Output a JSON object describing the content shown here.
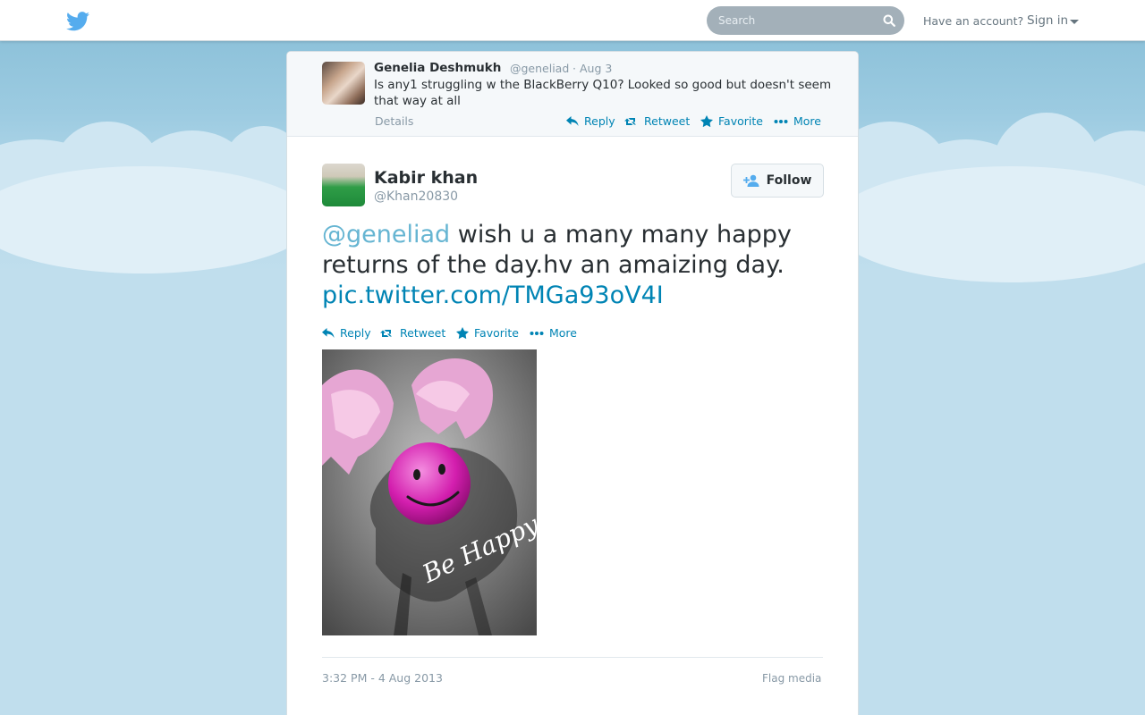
{
  "topbar": {
    "search_placeholder": "Search",
    "have_account": "Have an account?",
    "sign_in": "Sign in"
  },
  "colors": {
    "link": "#0084b4",
    "muted": "#8899a6",
    "text": "#292f33",
    "background": "#c0deed",
    "twitter_blue": "#55acee"
  },
  "ancestor_tweet": {
    "name": "Genelia Deshmukh",
    "handle": "@geneliad",
    "separator": "·",
    "date": "Aug 3",
    "text": "Is any1 struggling w the BlackBerry Q10? Looked so good but doesn't seem that way at all",
    "details": "Details",
    "actions": {
      "reply": "Reply",
      "retweet": "Retweet",
      "favorite": "Favorite",
      "more": "More"
    }
  },
  "main_tweet": {
    "name": "Kabir khan",
    "handle": "@Khan20830",
    "follow_label": "Follow",
    "mention": "@geneliad",
    "text": " wish u a many many happy returns of the day.hv an amaizing day. ",
    "link": "pic.twitter.com/TMGa93oV4I",
    "actions": {
      "reply": "Reply",
      "retweet": "Retweet",
      "favorite": "Favorite",
      "more": "More"
    },
    "photo_caption": "Be Happy",
    "timestamp": "3:32 PM - 4 Aug 2013",
    "flag_media": "Flag media"
  },
  "icons": [
    "twitter-bird-icon",
    "search-icon",
    "caret-down-icon",
    "reply-icon",
    "retweet-icon",
    "star-icon",
    "more-dots-icon",
    "follow-person-icon"
  ]
}
